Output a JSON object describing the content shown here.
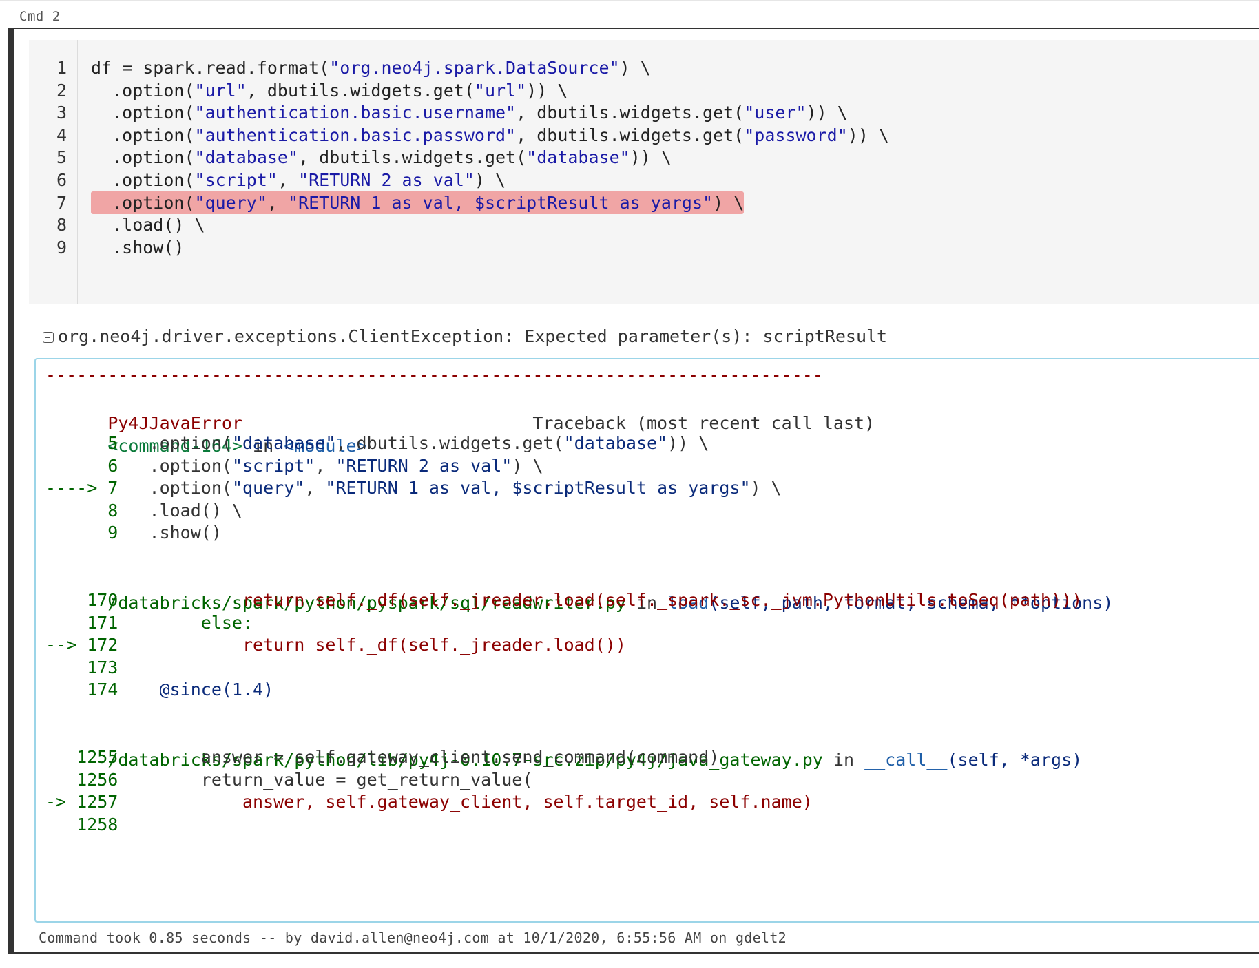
{
  "cell": {
    "label": "Cmd 2",
    "code_lines": [
      {
        "n": "1",
        "text": "df = spark.read.format(\"org.neo4j.spark.DataSource\") \\"
      },
      {
        "n": "2",
        "text": "  .option(\"url\", dbutils.widgets.get(\"url\")) \\"
      },
      {
        "n": "3",
        "text": "  .option(\"authentication.basic.username\", dbutils.widgets.get(\"user\")) \\"
      },
      {
        "n": "4",
        "text": "  .option(\"authentication.basic.password\", dbutils.widgets.get(\"password\")) \\"
      },
      {
        "n": "5",
        "text": "  .option(\"database\", dbutils.widgets.get(\"database\")) \\"
      },
      {
        "n": "6",
        "text": "  .option(\"script\", \"RETURN 2 as val\") \\"
      },
      {
        "n": "7",
        "text": "  .option(\"query\", \"RETURN 1 as val, $scriptResult as yargs\") \\"
      },
      {
        "n": "8",
        "text": "  .load() \\"
      },
      {
        "n": "9",
        "text": "  .show()"
      }
    ],
    "highlighted_line": "7",
    "error_header": "org.neo4j.driver.exceptions.ClientException: Expected parameter(s): scriptResult",
    "traceback": {
      "dashes": "---------------------------------------------------------------------------",
      "error_name": "Py4JJavaError",
      "traceback_label": "Traceback (most recent call last)",
      "frame1_cmd": "<command-164>",
      "frame1_in": " in ",
      "frame1_module": "<module>",
      "frame1_lines": [
        {
          "arrow": "      ",
          "n": "5",
          "code": "   .option(\"database\", dbutils.widgets.get(\"database\")) \\"
        },
        {
          "arrow": "      ",
          "n": "6",
          "code": "   .option(\"script\", \"RETURN 2 as val\") \\"
        },
        {
          "arrow": "----> ",
          "n": "7",
          "code": "   .option(\"query\", \"RETURN 1 as val, $scriptResult as yargs\") \\"
        },
        {
          "arrow": "      ",
          "n": "8",
          "code": "   .load() \\"
        },
        {
          "arrow": "      ",
          "n": "9",
          "code": "   .show()"
        }
      ],
      "frame2_path": "/databricks/spark/python/pyspark/sql/readwriter.py",
      "frame2_in": " in ",
      "frame2_func": "load",
      "frame2_args": "(self, path, format, schema, **options)",
      "frame2_lines": [
        {
          "arrow": "    ",
          "n": "170",
          "code": "            return self._df(self._jreader.load(self._spark._sc._jvm.PythonUtils.toSeq(path)))"
        },
        {
          "arrow": "    ",
          "n": "171",
          "code": "        else:"
        },
        {
          "arrow": "--> ",
          "n": "172",
          "code": "            return self._df(self._jreader.load())"
        },
        {
          "arrow": "    ",
          "n": "173",
          "code": ""
        },
        {
          "arrow": "    ",
          "n": "174",
          "code": "    @since(1.4)"
        }
      ],
      "frame3_path": "/databricks/spark/python/lib/py4j-0.10.7-src.zip/py4j/java_gateway.py",
      "frame3_in": " in ",
      "frame3_func": "__call__",
      "frame3_args": "(self, *args)",
      "frame3_lines": [
        {
          "arrow": "   ",
          "n": "1255",
          "code": "        answer = self.gateway_client.send_command(command)"
        },
        {
          "arrow": "   ",
          "n": "1256",
          "code": "        return_value = get_return_value("
        },
        {
          "arrow": "-> ",
          "n": "1257",
          "code": "            answer, self.gateway_client, self.target_id, self.name)"
        },
        {
          "arrow": "   ",
          "n": "1258",
          "code": ""
        }
      ]
    },
    "footer": "Command took 0.85 seconds -- by david.allen@neo4j.com at 10/1/2020, 6:55:56 AM on gdelt2"
  },
  "colors": {
    "highlight": "#f0a5a5",
    "error_red": "#8b0000",
    "traceback_green": "#006400",
    "output_border": "#9cd5e8"
  }
}
